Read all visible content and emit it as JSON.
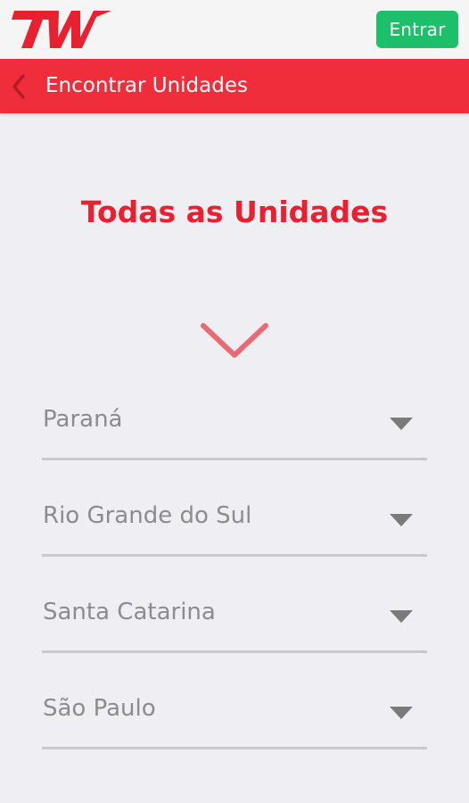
{
  "header": {
    "logo_text": "TW",
    "login_label": "Entrar"
  },
  "navbar": {
    "title": "Encontrar Unidades",
    "back_icon": "chevron-left-icon"
  },
  "main": {
    "heading": "Todas as Unidades",
    "expand_icon": "chevron-down-icon",
    "states": [
      {
        "label": "Paraná"
      },
      {
        "label": "Rio Grande do Sul"
      },
      {
        "label": "Santa Catarina"
      },
      {
        "label": "São Paulo"
      }
    ],
    "dropdown_icon": "caret-down-icon"
  },
  "colors": {
    "brand_red": "#ef2d3b",
    "heading_red": "#e8202f",
    "login_green": "#1ebf6a",
    "background": "#efeff3",
    "chevron_pink": "#e86a73",
    "text_gray": "#8c8c8c"
  }
}
